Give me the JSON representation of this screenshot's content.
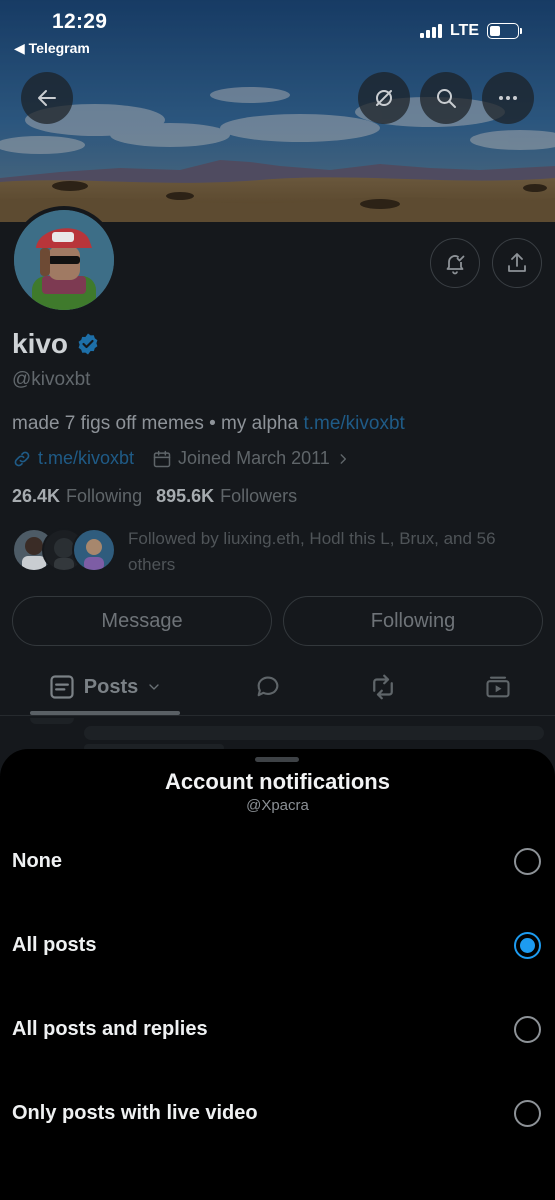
{
  "status_bar": {
    "time": "12:29",
    "back_app": "◀ Telegram",
    "network": "LTE"
  },
  "profile": {
    "name": "kivo",
    "handle": "@kivoxbt",
    "bio_text": "made 7 figs off memes • my alpha ",
    "bio_link": "t.me/kivoxbt",
    "website": "t.me/kivoxbt",
    "joined": "Joined March 2011",
    "following_count": "26.4K",
    "following_label": "Following",
    "followers_count": "895.6K",
    "followers_label": "Followers",
    "followed_by": "Followed by liuxing.eth, Hodl this L, Brux, and 56 others",
    "message_label": "Message",
    "following_button_label": "Following",
    "verified_color": "#1d9bf0"
  },
  "tabs": {
    "posts_label": "Posts"
  },
  "sheet": {
    "title": "Account notifications",
    "subtitle": "@Xpacra",
    "options": [
      {
        "label": "None",
        "selected": false
      },
      {
        "label": "All posts",
        "selected": true
      },
      {
        "label": "All posts and replies",
        "selected": false
      },
      {
        "label": "Only posts with live video",
        "selected": false
      }
    ],
    "accent_color": "#1d9bf0"
  },
  "icons": {
    "back": "arrow-left-icon",
    "no_notifications": "bell-slash-icon",
    "search": "search-icon",
    "more": "more-horizontal-icon",
    "notify": "bell-check-icon",
    "share": "share-icon",
    "link": "link-icon",
    "calendar": "calendar-icon",
    "posts": "posts-icon",
    "replies": "reply-icon",
    "reposts": "repost-icon",
    "media": "video-icon"
  }
}
